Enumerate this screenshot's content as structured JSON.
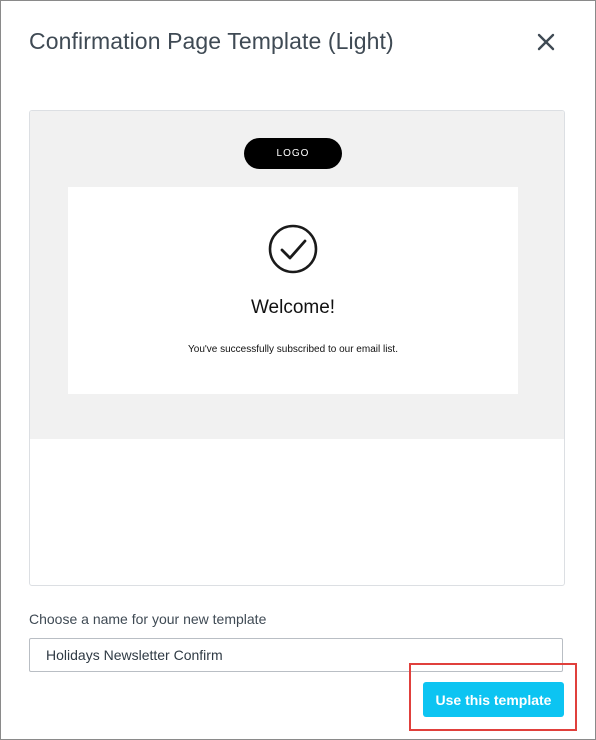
{
  "dialog": {
    "title": "Confirmation Page Template (Light)",
    "close_icon": "close-icon"
  },
  "preview": {
    "logo_text": "LOGO",
    "check_icon": "checkmark-circle-icon",
    "heading": "Welcome!",
    "message": "You've successfully subscribed to our email list."
  },
  "form": {
    "name_label": "Choose a name for your new template",
    "name_value": "Holidays Newsletter Confirm",
    "submit_label": "Use this template"
  },
  "colors": {
    "accent": "#0cc4f2",
    "highlight": "#e0403c",
    "preview_background": "#f1f1f1"
  }
}
